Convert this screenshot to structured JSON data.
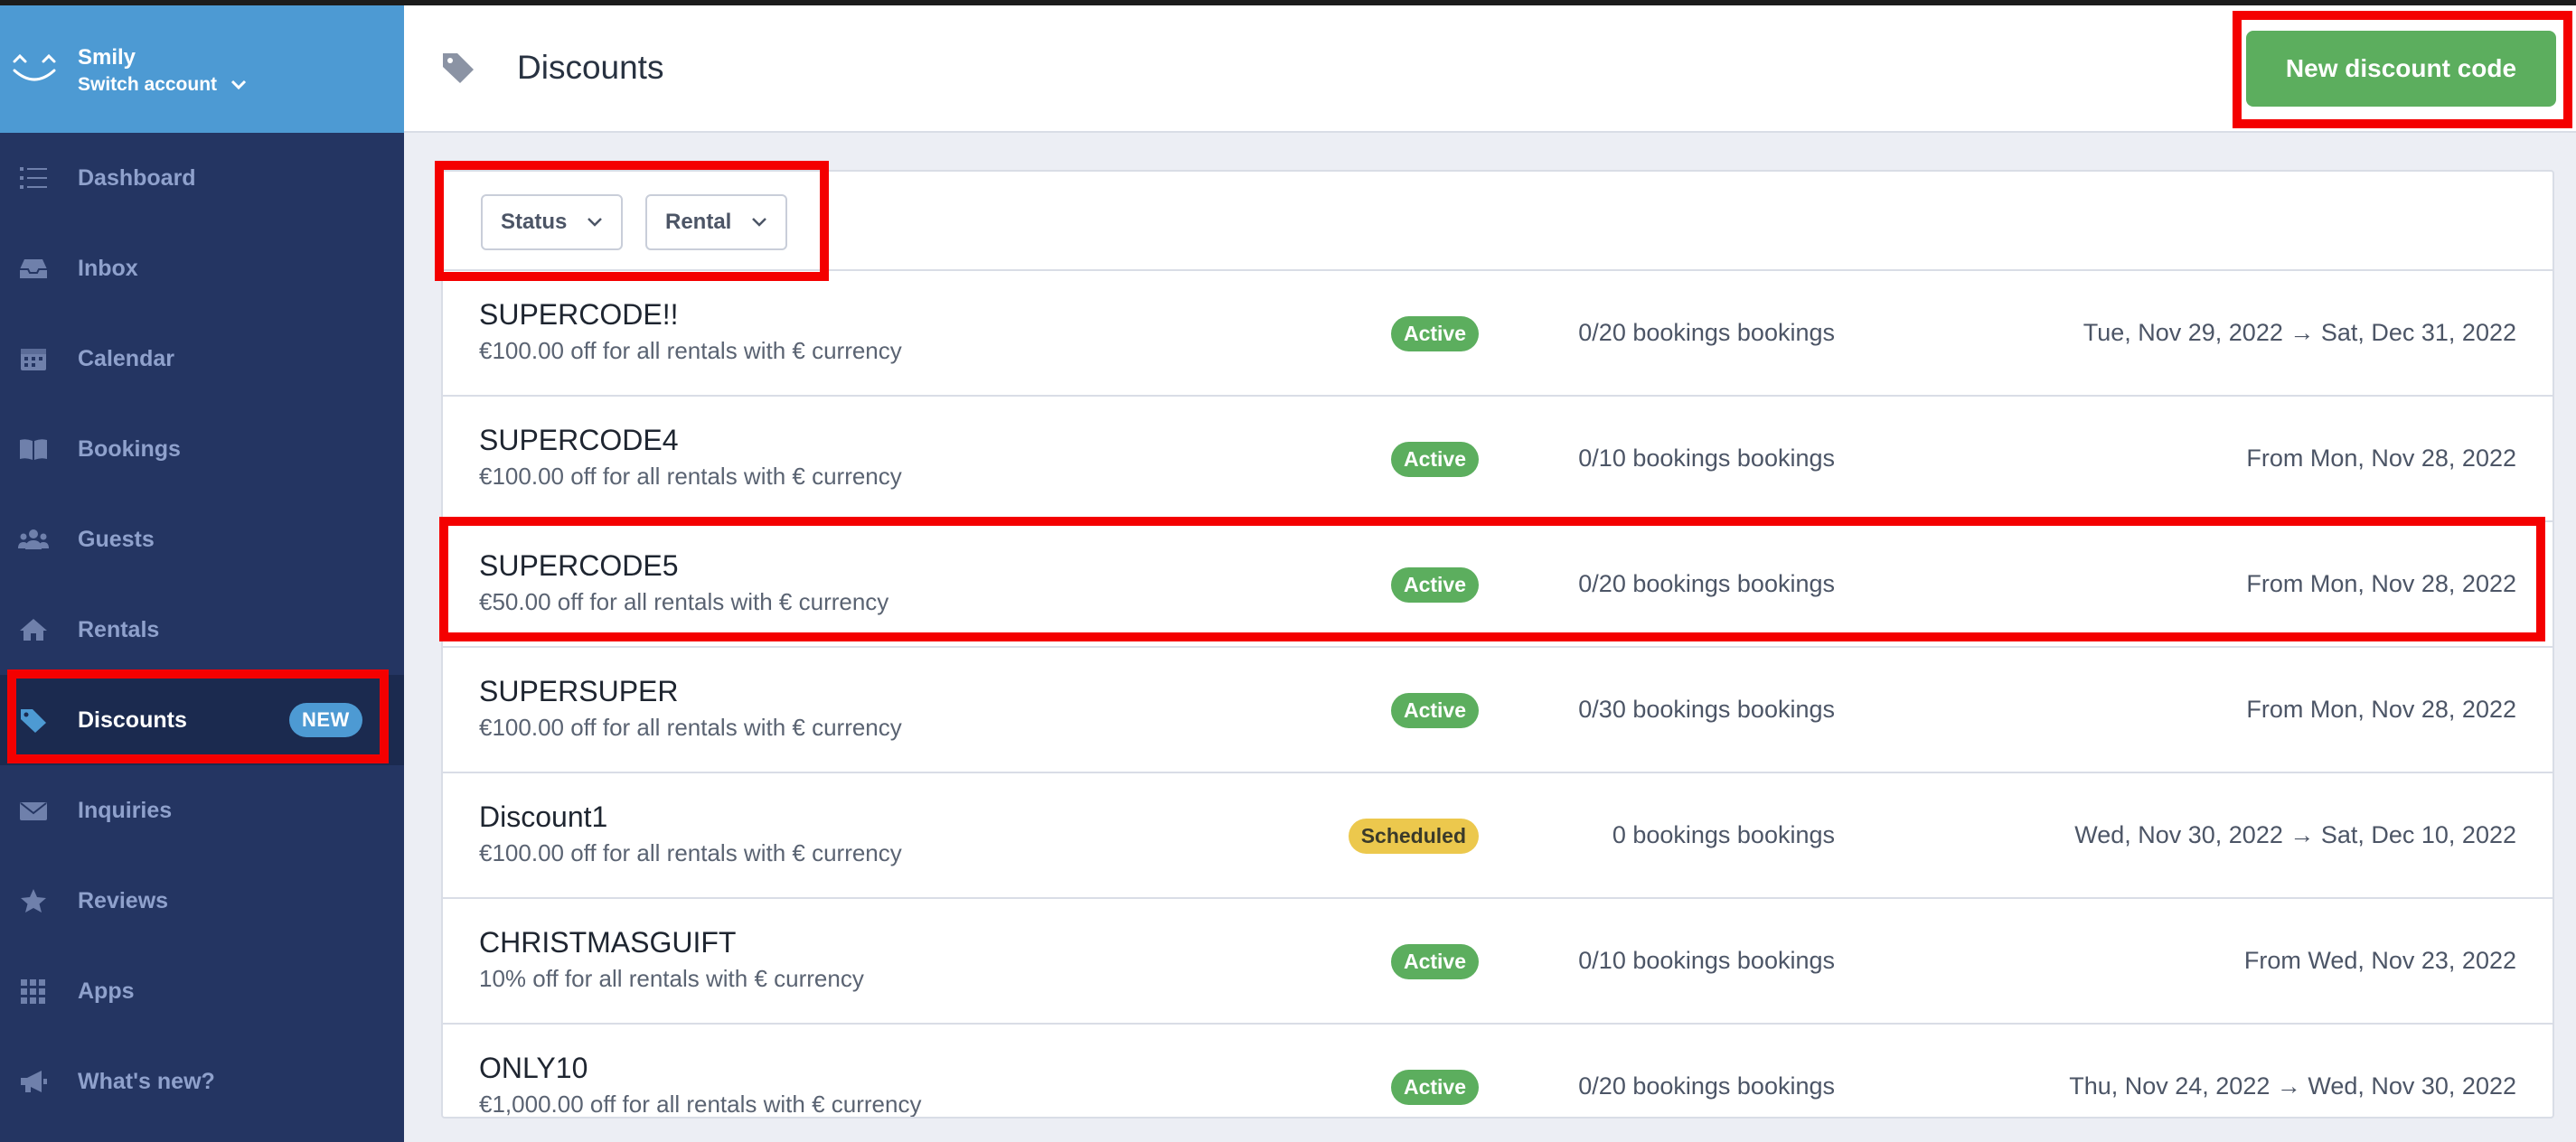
{
  "account": {
    "name": "Smily",
    "switch_label": "Switch account"
  },
  "sidebar": {
    "items": [
      {
        "label": "Dashboard",
        "icon": "list-icon"
      },
      {
        "label": "Inbox",
        "icon": "inbox-icon"
      },
      {
        "label": "Calendar",
        "icon": "calendar-icon"
      },
      {
        "label": "Bookings",
        "icon": "book-icon"
      },
      {
        "label": "Guests",
        "icon": "users-icon"
      },
      {
        "label": "Rentals",
        "icon": "home-icon"
      },
      {
        "label": "Discounts",
        "icon": "tag-icon",
        "active": true,
        "badge": "NEW"
      },
      {
        "label": "Inquiries",
        "icon": "envelope-icon"
      },
      {
        "label": "Reviews",
        "icon": "star-icon"
      },
      {
        "label": "Apps",
        "icon": "grid-icon"
      },
      {
        "label": "What's new?",
        "icon": "megaphone-icon"
      }
    ]
  },
  "header": {
    "title": "Discounts",
    "new_button": "New discount code"
  },
  "filters": {
    "status": "Status",
    "rental": "Rental"
  },
  "discounts": [
    {
      "code": "SUPERCODE!!",
      "description": "€100.00 off for all rentals with € currency",
      "status": "Active",
      "bookings": "0/20 bookings bookings",
      "dates": "Tue, Nov 29, 2022 → Sat, Dec 31, 2022"
    },
    {
      "code": "SUPERCODE4",
      "description": "€100.00 off for all rentals with € currency",
      "status": "Active",
      "bookings": "0/10 bookings bookings",
      "dates": "From Mon, Nov 28, 2022"
    },
    {
      "code": "SUPERCODE5",
      "description": "€50.00 off for all rentals with € currency",
      "status": "Active",
      "bookings": "0/20 bookings bookings",
      "dates": "From Mon, Nov 28, 2022"
    },
    {
      "code": "SUPERSUPER",
      "description": "€100.00 off for all rentals with € currency",
      "status": "Active",
      "bookings": "0/30 bookings bookings",
      "dates": "From Mon, Nov 28, 2022"
    },
    {
      "code": "Discount1",
      "description": "€100.00 off for all rentals with € currency",
      "status": "Scheduled",
      "bookings": "0 bookings bookings",
      "dates": "Wed, Nov 30, 2022 → Sat, Dec 10, 2022"
    },
    {
      "code": "CHRISTMASGUIFT",
      "description": "10% off for all rentals with € currency",
      "status": "Active",
      "bookings": "0/10 bookings bookings",
      "dates": "From Wed, Nov 23, 2022"
    },
    {
      "code": "ONLY10",
      "description": "€1,000.00 off for all rentals with € currency",
      "status": "Active",
      "bookings": "0/20 bookings bookings",
      "dates": "Thu, Nov 24, 2022 → Wed, Nov 30, 2022"
    }
  ],
  "colors": {
    "sidebar": "#243562",
    "account_bar": "#4d9ad3",
    "active_green": "#5cae5e",
    "scheduled_yellow": "#ecc84d",
    "highlight_red": "#f40000"
  }
}
